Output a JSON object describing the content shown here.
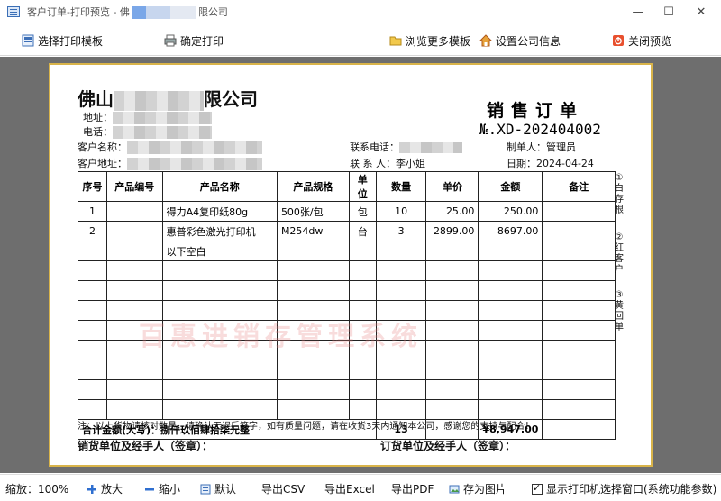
{
  "window": {
    "title_prefix": "客户订单-打印预览 - 佛",
    "title_suffix": "限公司",
    "minimize": "—",
    "maximize": "☐",
    "close": "✕"
  },
  "toolbar": {
    "select_template": "选择打印模板",
    "confirm_print": "确定打印",
    "browse_templates": "浏览更多模板",
    "company_info": "设置公司信息",
    "close_preview": "关闭预览"
  },
  "document": {
    "company_prefix": "佛山",
    "company_suffix": "限公司",
    "address_label": "地址：",
    "phone_label": "电话：",
    "title": "销售订单",
    "number": "№.XD-202404002",
    "customer_name_label": "客户名称：",
    "customer_address_label": "客户地址：",
    "contact_phone_label": "联系电话：",
    "contact_person": "联 系 人：李小姐",
    "creator": "制单人：管理员",
    "date": "日期：2024-04-24",
    "columns": [
      "序号",
      "产品编号",
      "产品名称",
      "产品规格",
      "单位",
      "数量",
      "单价",
      "金额",
      "备注"
    ],
    "rows": [
      [
        "1",
        "",
        "得力A4复印纸80g",
        "500张/包",
        "包",
        "10",
        "25.00",
        "250.00",
        ""
      ],
      [
        "2",
        "",
        "惠普彩色激光打印机",
        "M254dw",
        "台",
        "3",
        "2899.00",
        "8697.00",
        ""
      ],
      [
        "",
        "",
        "以下空白",
        "",
        "",
        "",
        "",
        "",
        ""
      ]
    ],
    "blank_row_count": 8,
    "total_label": "合计金额(大写)：捌仟玖佰肆拾柒元整",
    "total_qty": "13",
    "total_amount": "¥8,947.00",
    "watermark": "百惠进销存管理系统",
    "note": "注：以上货物请核对数量，请确认无误后签字，如有质量问题，请在收货3天内通知本公司，感谢您的支持与配合！",
    "seller_sign": "销货单位及经手人（签章）：",
    "buyer_sign": "订货单位及经手人（签章）：",
    "side_notes": [
      "①白存根",
      "②红客户",
      "③黄回单"
    ]
  },
  "statusbar": {
    "zoom": "缩放：100%",
    "zoom_in": "放大",
    "zoom_out": "缩小",
    "default": "默认",
    "export_csv": "导出CSV",
    "export_excel": "导出Excel",
    "export_pdf": "导出PDF",
    "save_image": "存为图片",
    "show_printer_dialog": "显示打印机选择窗口(系统功能参数)"
  },
  "colors": {
    "preview_bg": "#6e6e6e",
    "paper_border": "#d9b44a",
    "watermark": "#e68282"
  }
}
